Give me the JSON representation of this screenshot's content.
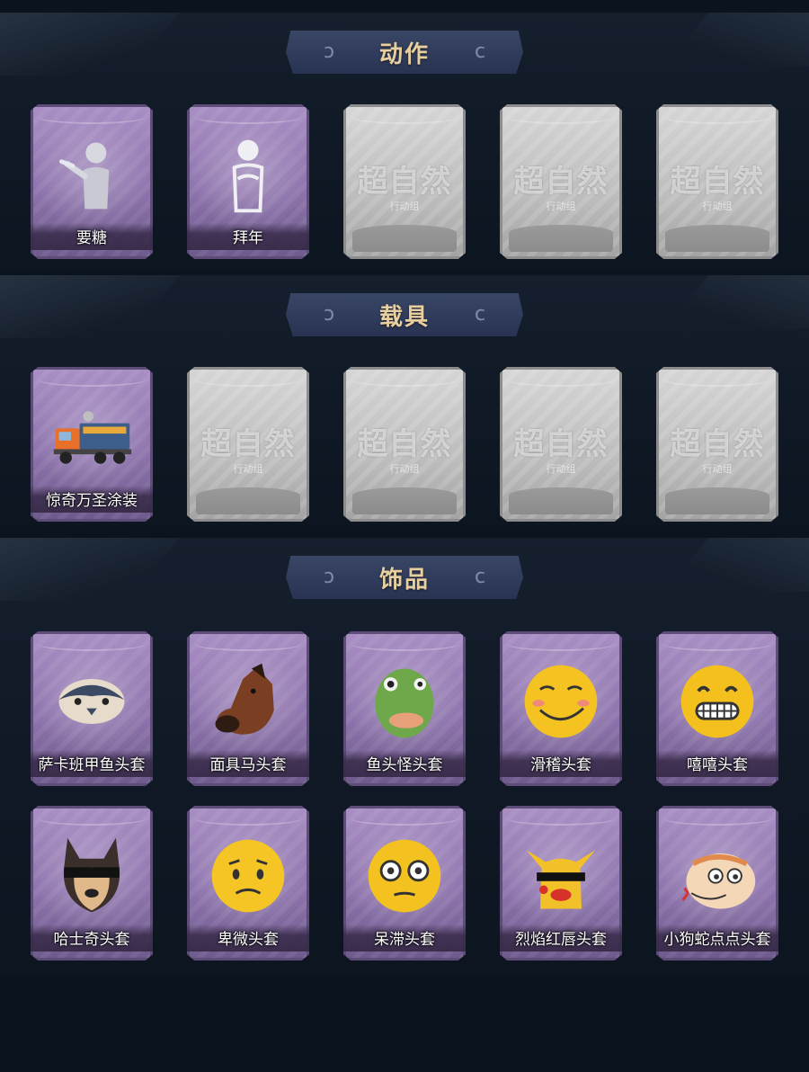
{
  "sections": [
    {
      "title": "动作",
      "items": [
        {
          "type": "purple",
          "label": "要糖",
          "icon": "pose-figure-icon"
        },
        {
          "type": "purple",
          "label": "拜年",
          "icon": "pose-figure-icon"
        },
        {
          "type": "gray",
          "placeholder_title": "超自然",
          "placeholder_sub": "行动组"
        },
        {
          "type": "gray",
          "placeholder_title": "超自然",
          "placeholder_sub": "行动组"
        },
        {
          "type": "gray",
          "placeholder_title": "超自然",
          "placeholder_sub": "行动组"
        }
      ]
    },
    {
      "title": "载具",
      "items": [
        {
          "type": "purple",
          "label": "惊奇万圣涂装",
          "icon": "truck-icon"
        },
        {
          "type": "gray",
          "placeholder_title": "超自然",
          "placeholder_sub": "行动组"
        },
        {
          "type": "gray",
          "placeholder_title": "超自然",
          "placeholder_sub": "行动组"
        },
        {
          "type": "gray",
          "placeholder_title": "超自然",
          "placeholder_sub": "行动组"
        },
        {
          "type": "gray",
          "placeholder_title": "超自然",
          "placeholder_sub": "行动组"
        }
      ]
    },
    {
      "title": "饰品",
      "items": [
        {
          "type": "purple",
          "label": "萨卡班甲鱼头套",
          "icon": "fish-mask-icon"
        },
        {
          "type": "purple",
          "label": "面具马头套",
          "icon": "horse-mask-icon"
        },
        {
          "type": "purple",
          "label": "鱼头怪头套",
          "icon": "green-fish-mask-icon"
        },
        {
          "type": "purple",
          "label": "滑稽头套",
          "icon": "smirk-emoji-mask-icon"
        },
        {
          "type": "purple",
          "label": "嘻嘻头套",
          "icon": "grin-emoji-mask-icon"
        },
        {
          "type": "purple",
          "label": "哈士奇头套",
          "icon": "husky-mask-icon"
        },
        {
          "type": "purple",
          "label": "卑微头套",
          "icon": "humble-emoji-mask-icon"
        },
        {
          "type": "purple",
          "label": "呆滞头套",
          "icon": "dazed-emoji-mask-icon"
        },
        {
          "type": "purple",
          "label": "烈焰红唇头套",
          "icon": "pikachu-mask-icon"
        },
        {
          "type": "purple",
          "label": "小狗蛇点点头套",
          "icon": "snake-mask-icon"
        }
      ]
    }
  ]
}
